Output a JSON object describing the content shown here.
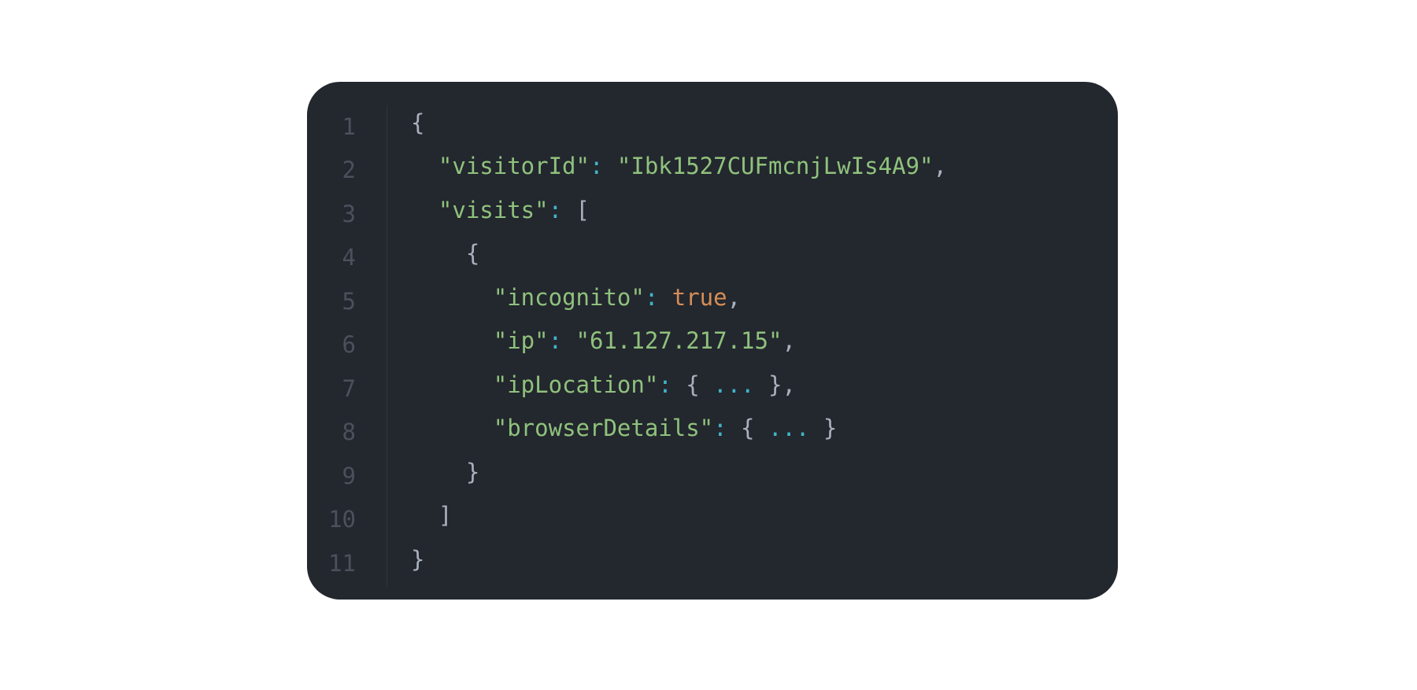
{
  "colors": {
    "background": "#ffffff",
    "panel": "#23272e",
    "line_number": "#4b515c",
    "punctuation": "#a9b1bd",
    "string": "#8fc27c",
    "colon": "#3fb5c9",
    "boolean": "#d68d55"
  },
  "lines": [
    {
      "number": "1",
      "tokens": [
        "",
        "{"
      ]
    },
    {
      "number": "2",
      "tokens": [
        "  ",
        "\"visitorId\"",
        ": ",
        "\"Ibk1527CUFmcnjLwIs4A9\"",
        ","
      ]
    },
    {
      "number": "3",
      "tokens": [
        "  ",
        "\"visits\"",
        ": ",
        "["
      ]
    },
    {
      "number": "4",
      "tokens": [
        "    ",
        "{"
      ]
    },
    {
      "number": "5",
      "tokens": [
        "      ",
        "\"incognito\"",
        ": ",
        "true",
        ","
      ]
    },
    {
      "number": "6",
      "tokens": [
        "      ",
        "\"ip\"",
        ": ",
        "\"61.127.217.15\"",
        ","
      ]
    },
    {
      "number": "7",
      "tokens": [
        "      ",
        "\"ipLocation\"",
        ": ",
        "{ ",
        "...",
        " }",
        ","
      ]
    },
    {
      "number": "8",
      "tokens": [
        "      ",
        "\"browserDetails\"",
        ": ",
        "{ ",
        "...",
        " }"
      ]
    },
    {
      "number": "9",
      "tokens": [
        "    ",
        "}"
      ]
    },
    {
      "number": "10",
      "tokens": [
        "  ",
        "]"
      ]
    },
    {
      "number": "11",
      "tokens": [
        "",
        "}"
      ]
    }
  ]
}
